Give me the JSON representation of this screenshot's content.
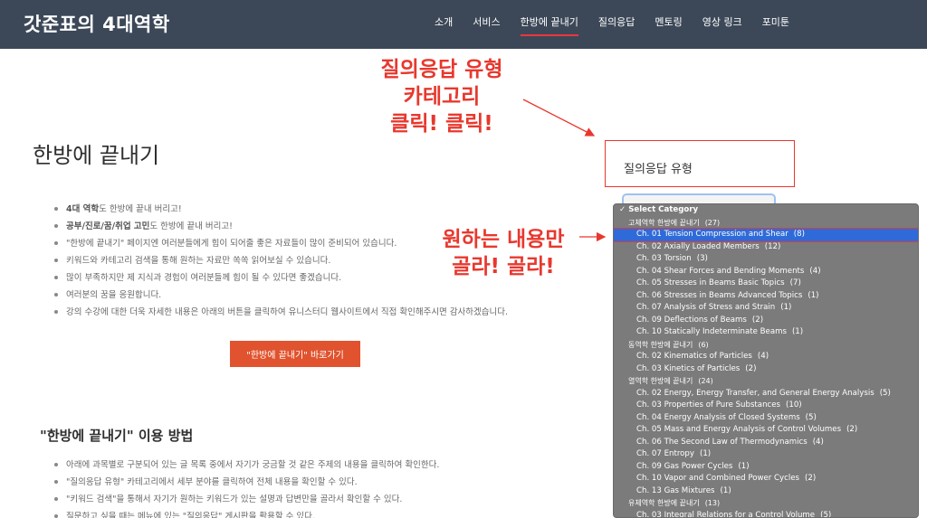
{
  "header": {
    "logo": "갓준표의 4대역학",
    "nav": [
      "소개",
      "서비스",
      "한방에 끝내기",
      "질의응답",
      "멘토링",
      "영상 링크",
      "포미툰"
    ],
    "active_nav": "한방에 끝내기"
  },
  "main": {
    "title": "한방에 끝내기",
    "bullets": [
      {
        "bold": "4대 역학",
        "text": "도 한방에 끝내 버리고!"
      },
      {
        "bold": "공부/진로/꿈/취업 고민",
        "text": "도 한방에 끝내 버리고!"
      },
      {
        "bold": "",
        "text": "\"한방에 끝내기\" 페이지엔 여러분들에게 힘이 되어줄 좋은 자료들이 많이 준비되어 있습니다."
      },
      {
        "bold": "",
        "text": "키워드와 카테고리 검색을 통해 원하는 자료만 쏙쏙 읽어보실 수 있습니다."
      },
      {
        "bold": "",
        "text": "많이 부족하지만 제 지식과 경험이 여러분들께 힘이 될 수 있다면 좋겠습니다."
      },
      {
        "bold": "",
        "text": "여러분의 꿈을 응원합니다."
      },
      {
        "bold": "",
        "text": "강의 수강에 대한 더욱 자세한 내용은 아래의 버튼을 클릭하여 유니스터디 웹사이트에서 직접 확인해주시면 감사하겠습니다."
      }
    ],
    "go_button": "\"한방에 끝내기\" 바로가기",
    "howto_title": "\"한방에 끝내기\" 이용 방법",
    "howto": [
      "아래에 과목별로 구분되어 있는 글 목록 중에서 자기가 궁금할 것 같은 주제의 내용을 클릭하여 확인한다.",
      "\"질의응답 유형\" 카테고리에서 세부 분야를 클릭하여 전체 내용을 확인할 수 있다.",
      "\"키워드 검색\"을 통해서 자기가 원하는 키워드가 있는 설명과 답변만을 골라서 확인할 수 있다.",
      "질문하고 싶을 때는 메뉴에 있는 \"질의응답\" 게시판을 활용할 수 있다."
    ]
  },
  "annotations": {
    "top": [
      "질의응답 유형",
      "카테고리",
      "클릭! 클릭!"
    ],
    "mid": [
      "원하는 내용만",
      "골라! 골라!"
    ],
    "color": "#e8382e"
  },
  "sidebar": {
    "heading": "질의응답 유형"
  },
  "dropdown": {
    "items": [
      {
        "level": "top",
        "label": "✓ Select Category",
        "count": ""
      },
      {
        "level": "cat",
        "label": "고체역학 한방에 끝내기",
        "count": "(27)"
      },
      {
        "level": "sub",
        "label": "Ch. 01 Tension Compression and Shear",
        "count": "(8)",
        "selected": true
      },
      {
        "level": "sub",
        "label": "Ch. 02 Axially Loaded Members",
        "count": "(12)"
      },
      {
        "level": "sub",
        "label": "Ch. 03 Torsion",
        "count": "(3)"
      },
      {
        "level": "sub",
        "label": "Ch. 04 Shear Forces and Bending Moments",
        "count": "(4)"
      },
      {
        "level": "sub",
        "label": "Ch. 05 Stresses in Beams Basic Topics",
        "count": "(7)"
      },
      {
        "level": "sub",
        "label": "Ch. 06 Stresses in Beams Advanced Topics",
        "count": "(1)"
      },
      {
        "level": "sub",
        "label": "Ch. 07 Analysis of Stress and Strain",
        "count": "(1)"
      },
      {
        "level": "sub",
        "label": "Ch. 09 Deflections of Beams",
        "count": "(2)"
      },
      {
        "level": "sub",
        "label": "Ch. 10 Statically Indeterminate Beams",
        "count": "(1)"
      },
      {
        "level": "cat",
        "label": "동역학 한방에 끝내기",
        "count": "(6)"
      },
      {
        "level": "sub",
        "label": "Ch. 02 Kinematics of Particles",
        "count": "(4)"
      },
      {
        "level": "sub",
        "label": "Ch. 03 Kinetics of Particles",
        "count": "(2)"
      },
      {
        "level": "cat",
        "label": "열역학 한방에 끝내기",
        "count": "(24)"
      },
      {
        "level": "sub",
        "label": "Ch. 02 Energy, Energy Transfer, and General Energy Analysis",
        "count": "(5)"
      },
      {
        "level": "sub",
        "label": "Ch. 03 Properties of Pure Substances",
        "count": "(10)"
      },
      {
        "level": "sub",
        "label": "Ch. 04 Energy Analysis of Closed Systems",
        "count": "(5)"
      },
      {
        "level": "sub",
        "label": "Ch. 05 Mass and Energy Analysis of Control Volumes",
        "count": "(2)"
      },
      {
        "level": "sub",
        "label": "Ch. 06 The Second Law of Thermodynamics",
        "count": "(4)"
      },
      {
        "level": "sub",
        "label": "Ch. 07 Entropy",
        "count": "(1)"
      },
      {
        "level": "sub",
        "label": "Ch. 09 Gas Power Cycles",
        "count": "(1)"
      },
      {
        "level": "sub",
        "label": "Ch. 10 Vapor and Combined Power Cycles",
        "count": "(2)"
      },
      {
        "level": "sub",
        "label": "Ch. 13 Gas Mixtures",
        "count": "(1)"
      },
      {
        "level": "cat",
        "label": "유체역학 한방에 끝내기",
        "count": "(13)"
      },
      {
        "level": "sub",
        "label": "Ch. 03 Integral Relations for a Control Volume",
        "count": "(5)"
      }
    ]
  }
}
